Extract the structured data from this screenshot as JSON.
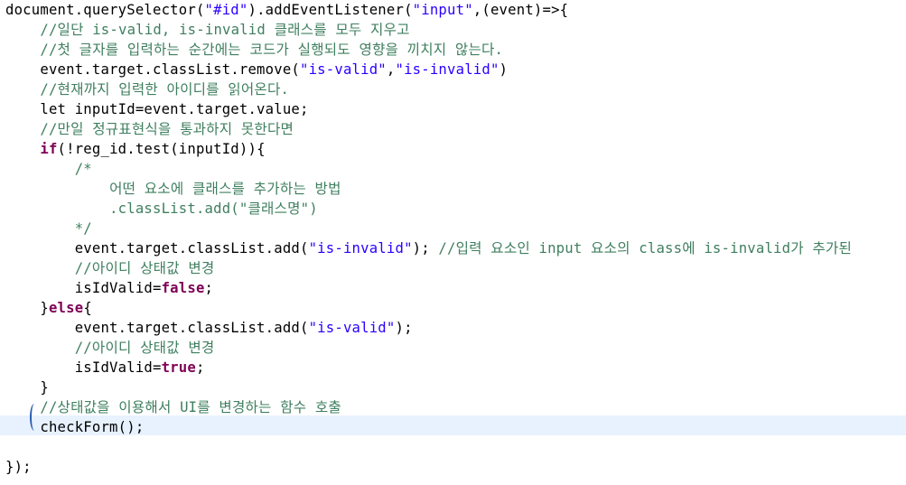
{
  "editor": {
    "current_line_color": "#e8f2fe",
    "colors": {
      "comment": "#3f7f5f",
      "string": "#2a00ff",
      "keyword": "#7f0055",
      "plain": "#000000"
    },
    "lines": [
      [
        [
          "p",
          "document.querySelector("
        ],
        [
          "s",
          "\"#id\""
        ],
        [
          "p",
          ").addEventListener("
        ],
        [
          "s",
          "\"input\""
        ],
        [
          "p",
          ",(event)=>{"
        ]
      ],
      [
        [
          "p",
          "    "
        ],
        [
          "c",
          "//일단 is-valid, is-invalid 클래스를 모두 지우고"
        ]
      ],
      [
        [
          "p",
          "    "
        ],
        [
          "c",
          "//첫 글자를 입력하는 순간에는 코드가 실행되도 영향을 끼치지 않는다."
        ]
      ],
      [
        [
          "p",
          "    event.target.classList.remove("
        ],
        [
          "s",
          "\"is-valid\""
        ],
        [
          "p",
          ","
        ],
        [
          "s",
          "\"is-invalid\""
        ],
        [
          "p",
          ")"
        ]
      ],
      [
        [
          "p",
          "    "
        ],
        [
          "c",
          "//현재까지 입력한 아이디를 읽어온다."
        ]
      ],
      [
        [
          "p",
          "    let inputId=event.target.value;"
        ]
      ],
      [
        [
          "p",
          "    "
        ],
        [
          "c",
          "//만일 정규표현식을 통과하지 못한다면"
        ]
      ],
      [
        [
          "p",
          "    "
        ],
        [
          "k",
          "if"
        ],
        [
          "p",
          "(!reg_id.test(inputId)){"
        ]
      ],
      [
        [
          "p",
          "        "
        ],
        [
          "c",
          "/*"
        ]
      ],
      [
        [
          "p",
          "            "
        ],
        [
          "c",
          "어떤 요소에 클래스를 추가하는 방법"
        ]
      ],
      [
        [
          "p",
          "            "
        ],
        [
          "c",
          ".classList.add(\"클래스명\")"
        ]
      ],
      [
        [
          "p",
          "        "
        ],
        [
          "c",
          "*/"
        ]
      ],
      [
        [
          "p",
          "        event.target.classList.add("
        ],
        [
          "s",
          "\"is-invalid\""
        ],
        [
          "p",
          "); "
        ],
        [
          "c",
          "//입력 요소인 input 요소의 class에 is-invalid가 추가된"
        ]
      ],
      [
        [
          "p",
          "        "
        ],
        [
          "c",
          "//아이디 상태값 변경"
        ]
      ],
      [
        [
          "p",
          "        isIdValid="
        ],
        [
          "k",
          "false"
        ],
        [
          "p",
          ";"
        ]
      ],
      [
        [
          "p",
          "    }"
        ],
        [
          "k",
          "else"
        ],
        [
          "p",
          "{"
        ]
      ],
      [
        [
          "p",
          "        event.target.classList.add("
        ],
        [
          "s",
          "\"is-valid\""
        ],
        [
          "p",
          ");"
        ]
      ],
      [
        [
          "p",
          "        "
        ],
        [
          "c",
          "//아이디 상태값 변경"
        ]
      ],
      [
        [
          "p",
          "        isIdValid="
        ],
        [
          "k",
          "true"
        ],
        [
          "p",
          ";"
        ]
      ],
      [
        [
          "p",
          "    }"
        ]
      ],
      [
        [
          "p",
          "    "
        ],
        [
          "c",
          "//상태값을 이용해서 UI를 변경하는 함수 호출"
        ]
      ],
      [
        [
          "p",
          "    checkForm();"
        ]
      ],
      [
        [
          "p",
          ""
        ]
      ],
      [
        [
          "p",
          "});"
        ]
      ]
    ]
  }
}
